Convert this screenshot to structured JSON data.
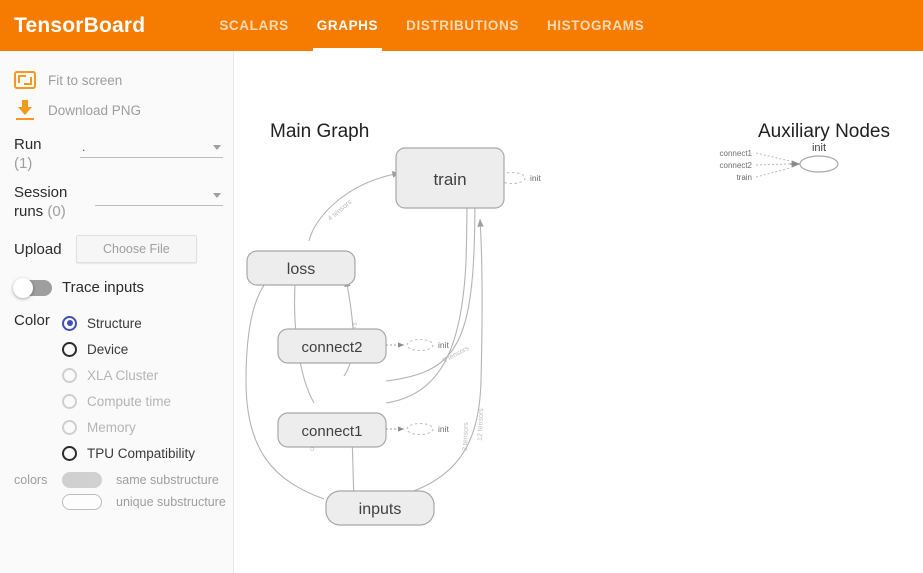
{
  "header": {
    "brand": "TensorBoard",
    "tabs": [
      {
        "label": "SCALARS",
        "active": false
      },
      {
        "label": "GRAPHS",
        "active": true
      },
      {
        "label": "DISTRIBUTIONS",
        "active": false
      },
      {
        "label": "HISTOGRAMS",
        "active": false
      }
    ]
  },
  "sidebar": {
    "fit_to_screen": "Fit to screen",
    "download_png": "Download PNG",
    "run_label": "Run",
    "run_count": "(1)",
    "run_value": ".",
    "session_label": "Session runs",
    "session_count": "(0)",
    "session_value": "",
    "upload_label": "Upload",
    "choose_file": "Choose File",
    "trace_inputs": "Trace inputs",
    "color_label": "Color",
    "color_options": [
      {
        "label": "Structure",
        "selected": true,
        "disabled": false
      },
      {
        "label": "Device",
        "selected": false,
        "disabled": false
      },
      {
        "label": "XLA Cluster",
        "selected": false,
        "disabled": true
      },
      {
        "label": "Compute time",
        "selected": false,
        "disabled": true
      },
      {
        "label": "Memory",
        "selected": false,
        "disabled": true
      },
      {
        "label": "TPU Compatibility",
        "selected": false,
        "disabled": false
      }
    ],
    "legend_key": "colors",
    "legend_same": "same substructure",
    "legend_unique": "unique substructure"
  },
  "main": {
    "graph_title": "Main Graph",
    "aux_title": "Auxiliary Nodes",
    "nodes": [
      {
        "id": "train",
        "label": "train"
      },
      {
        "id": "loss",
        "label": "loss"
      },
      {
        "id": "connect2",
        "label": "connect2"
      },
      {
        "id": "connect1",
        "label": "connect1"
      },
      {
        "id": "inputs",
        "label": "inputs"
      }
    ],
    "init_stubs": [
      {
        "owner": "train",
        "label": "init"
      },
      {
        "owner": "connect2",
        "label": "init"
      },
      {
        "owner": "connect1",
        "label": "init"
      }
    ],
    "edge_labels": [
      {
        "id": "loss-train",
        "label": "4 tensors"
      },
      {
        "id": "connect2-loss",
        "label": "2 tensors"
      },
      {
        "id": "connect2-train",
        "label": "9 tensors"
      },
      {
        "id": "connect1-train",
        "label": "2 tensors"
      },
      {
        "id": "inputs-train",
        "label": "12 tensors"
      },
      {
        "id": "connect1-loss",
        "label": "out"
      }
    ],
    "aux": {
      "init_label": "init",
      "sources": [
        "connect1",
        "connect2",
        "train"
      ]
    }
  },
  "colors": {
    "brand_orange": "#f57c00",
    "accent_orange": "#f3991d",
    "radio_blue": "#3f51b5",
    "node_fill": "#ededed",
    "node_stroke": "#a8a8a8",
    "edge_stroke": "#b0b0b0",
    "sidebar_bg": "#fafafa"
  }
}
